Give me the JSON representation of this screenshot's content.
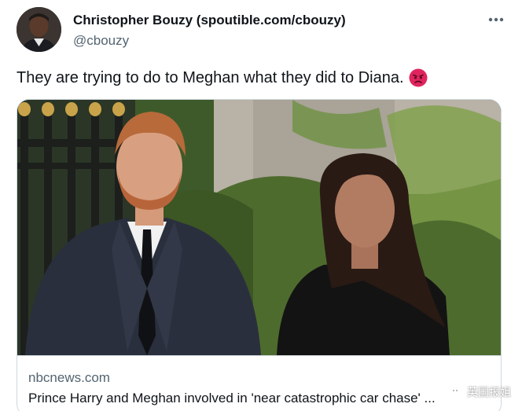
{
  "author": {
    "name": "Christopher Bouzy (spoutible.com/cbouzy)",
    "handle": "@cbouzy",
    "avatar_icon": "avatar-photo"
  },
  "more_icon": "more-horizontal-icon",
  "tweet": {
    "text": "They are trying to do to Meghan what they did to Diana.",
    "emoji_icon": "pouting-face-emoji"
  },
  "card": {
    "image_icon": "photo-harry-and-meghan",
    "domain": "nbcnews.com",
    "title": "Prince Harry and Meghan involved in 'near catastrophic car chase' ..."
  },
  "watermark": {
    "text": "英国报姐",
    "icon": "wechat-icon"
  },
  "colors": {
    "text_primary": "#0f1419",
    "text_secondary": "#536471",
    "border": "#cfd9de",
    "emoji_red": "#e0245e"
  }
}
